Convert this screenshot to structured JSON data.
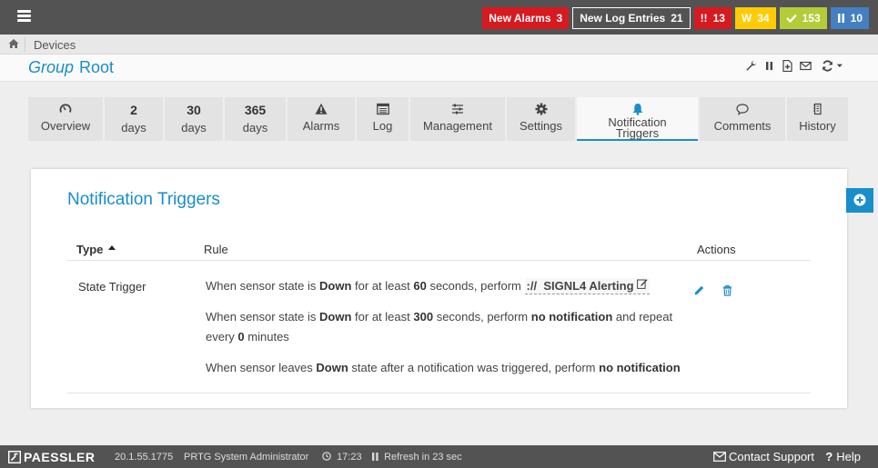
{
  "topbar": {
    "new_alarms_label": "New Alarms",
    "new_alarms_count": "3",
    "new_log_label": "New Log Entries",
    "new_log_count": "21",
    "down_icon": "!!",
    "down_count": "13",
    "warning_icon": "W",
    "warning_count": "34",
    "up_count": "153",
    "paused_count": "10"
  },
  "breadcrumb": {
    "item": "Devices"
  },
  "page_title": {
    "kind": "Group",
    "name": "Root"
  },
  "tabs": [
    {
      "top": "",
      "label": "Overview",
      "icon": "gauge-icon"
    },
    {
      "top": "2",
      "label": "days"
    },
    {
      "top": "30",
      "label": "days"
    },
    {
      "top": "365",
      "label": "days"
    },
    {
      "top": "",
      "label": "Alarms",
      "icon": "warning-icon"
    },
    {
      "top": "",
      "label": "Log",
      "icon": "list-icon"
    },
    {
      "top": "",
      "label": "Management",
      "icon": "sliders-icon"
    },
    {
      "top": "",
      "label": "Settings",
      "icon": "gear-icon"
    },
    {
      "top": "",
      "label": "Notification Triggers",
      "label_line1": "Notification",
      "label_line2": "Triggers",
      "icon": "bell-icon"
    },
    {
      "top": "",
      "label": "Comments",
      "icon": "comment-icon"
    },
    {
      "top": "",
      "label": "History",
      "icon": "history-icon"
    }
  ],
  "card": {
    "title": "Notification Triggers",
    "columns": {
      "type": "Type",
      "rule": "Rule",
      "actions": "Actions"
    },
    "row": {
      "type": "State Trigger",
      "rule1": {
        "pre": "When sensor state is",
        "state": "Down",
        "mid": "for at least",
        "secs": "60",
        "post": "seconds, perform",
        "notification": "SIGNL4 Alerting",
        "notification_prefix": "://"
      },
      "rule2": {
        "pre": "When sensor state is",
        "state": "Down",
        "mid": "for at least",
        "secs": "300",
        "post": "seconds, perform",
        "notification": "no notification",
        "repeat_pre": "and repeat every",
        "repeat_val": "0",
        "repeat_post": "minutes"
      },
      "rule3": {
        "pre": "When sensor leaves",
        "state": "Down",
        "post": "state after a notification was triggered, perform",
        "notification": "no notification"
      }
    }
  },
  "footer": {
    "logo": "PAESSLER",
    "version": "20.1.55.1775",
    "user": "PRTG System Administrator",
    "time": "17:23",
    "refresh": "Refresh in 23 sec",
    "contact": "Contact Support",
    "help": "Help"
  },
  "colors": {
    "accent": "#1a8ecb",
    "alarm_red": "#d71920",
    "warning_yellow": "#ffcb05",
    "up_green": "#b4cc38",
    "paused_blue": "#447fc1",
    "bar_gray": "#535353"
  }
}
